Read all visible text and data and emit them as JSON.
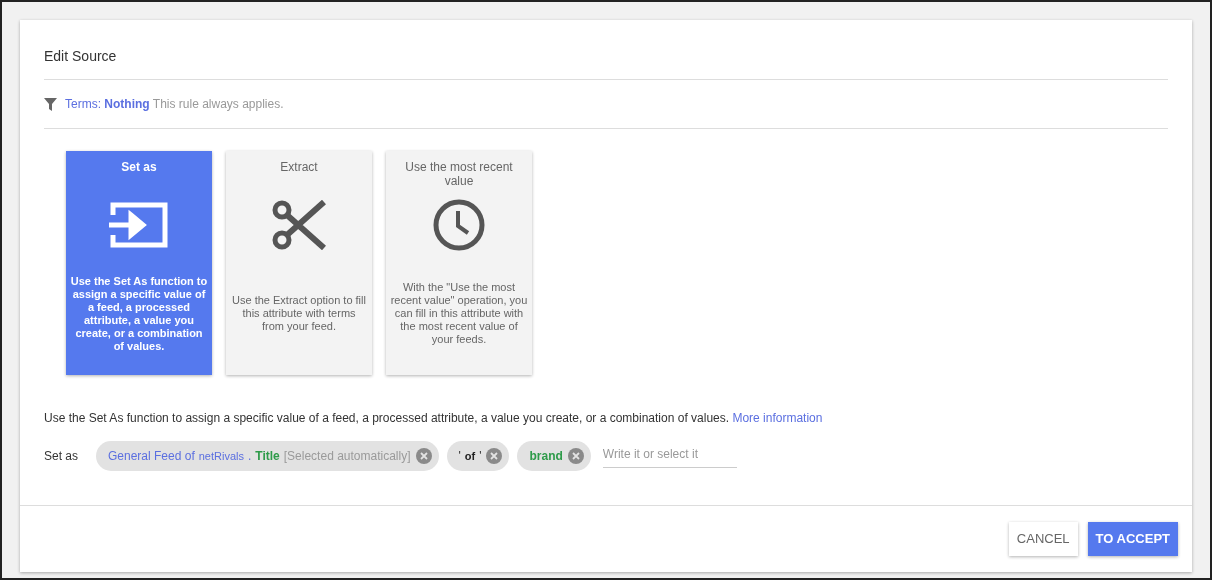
{
  "title": "Edit Source",
  "terms": {
    "label": "Terms:",
    "value": "Nothing",
    "note": "This rule always applies."
  },
  "options": [
    {
      "title": "Set as",
      "kind": "set",
      "selected": true,
      "description": "Use the Set As function to assign a specific value of a feed, a processed attribute, a value you create, or a combination of values."
    },
    {
      "title": "Extract",
      "kind": "extract",
      "selected": false,
      "description": "Use the Extract option to fill this attribute with terms from your feed."
    },
    {
      "title": "Use the most recent value",
      "kind": "recent",
      "selected": false,
      "description": "With the \"Use the most recent value\" operation, you can fill in this attribute with the most recent value of your feeds."
    }
  ],
  "help": {
    "text": "Use the Set As function to assign a specific value of a feed, a processed attribute, a value you create, or a combination of values.",
    "link": "More information"
  },
  "set_as": {
    "label": "Set as",
    "chips": [
      {
        "parts": [
          {
            "kind": "source",
            "text": "General Feed of"
          },
          {
            "kind": "feed",
            "text": "netRivals"
          },
          {
            "kind": "source",
            "text": "."
          },
          {
            "kind": "attribute",
            "text": "Title"
          },
          {
            "kind": "note",
            "text": "[Selected automatically]"
          }
        ]
      },
      {
        "parts": [
          {
            "kind": "quote",
            "text": "'"
          },
          {
            "kind": "literal",
            "text": "of"
          },
          {
            "kind": "quote",
            "text": "'"
          }
        ]
      },
      {
        "parts": [
          {
            "kind": "attribute",
            "text": "brand"
          }
        ]
      }
    ],
    "placeholder": "Write it or select it"
  },
  "buttons": [
    {
      "label": "CANCEL",
      "kind": "secondary"
    },
    {
      "label": "TO ACCEPT",
      "kind": "primary"
    }
  ]
}
